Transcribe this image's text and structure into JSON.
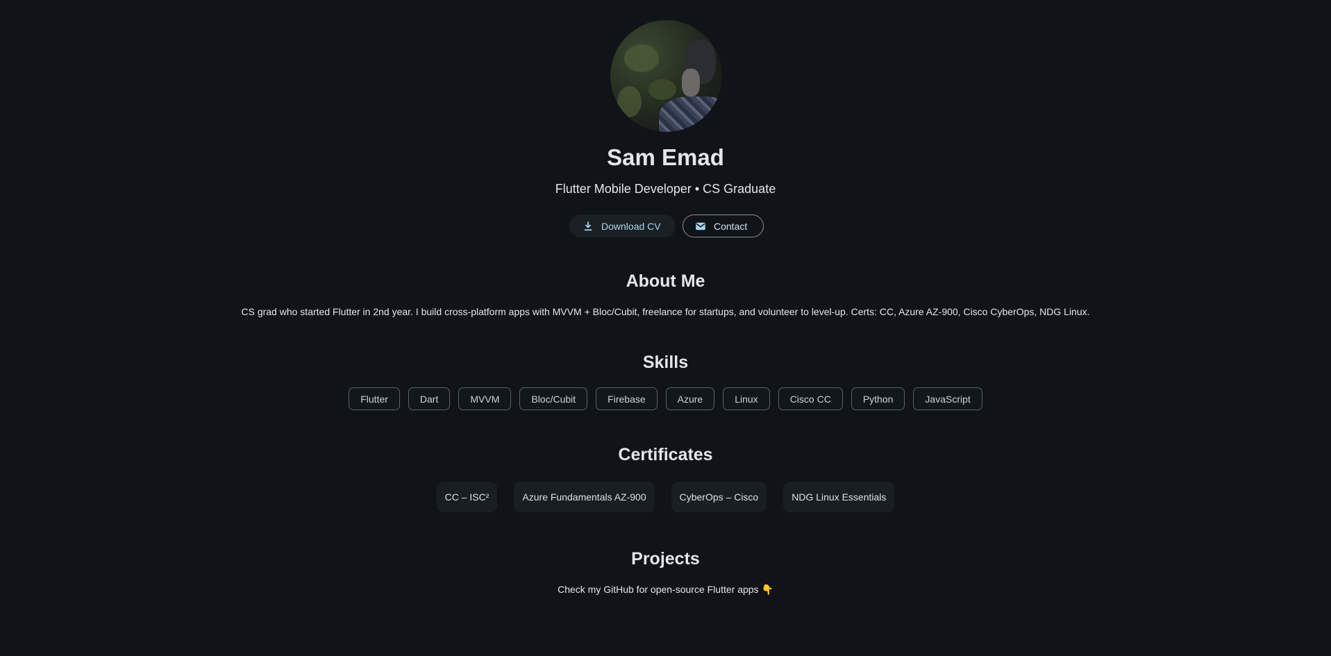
{
  "profile": {
    "name": "Sam Emad",
    "subtitle": "Flutter Mobile Developer • CS Graduate"
  },
  "actions": {
    "download_label": "Download CV",
    "contact_label": "Contact"
  },
  "about": {
    "title": "About Me",
    "text": "CS grad who started Flutter in 2nd year. I build cross-platform apps with MVVM + Bloc/Cubit, freelance for startups, and volunteer to level-up. Certs: CC, Azure AZ-900, Cisco CyberOps, NDG Linux."
  },
  "skills": {
    "title": "Skills",
    "items": [
      "Flutter",
      "Dart",
      "MVVM",
      "Bloc/Cubit",
      "Firebase",
      "Azure",
      "Linux",
      "Cisco CC",
      "Python",
      "JavaScript"
    ]
  },
  "certificates": {
    "title": "Certificates",
    "items": [
      "CC – ISC²",
      "Azure Fundamentals AZ-900",
      "CyberOps – Cisco",
      "NDG Linux Essentials"
    ]
  },
  "projects": {
    "title": "Projects",
    "text": "Check my GitHub for open-source Flutter apps",
    "emoji": "👇"
  },
  "icons": {
    "download": "download-icon",
    "contact": "mail-icon"
  },
  "colors": {
    "background": "#101418",
    "accent": "#a8d4f0"
  }
}
